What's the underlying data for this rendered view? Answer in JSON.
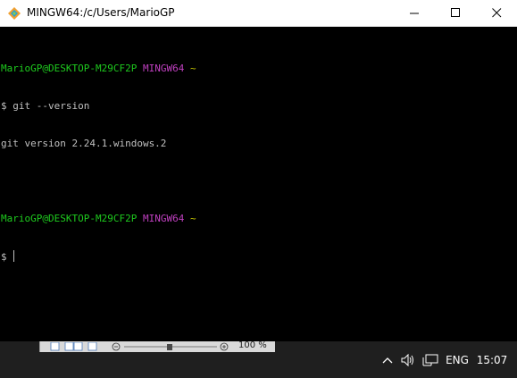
{
  "window": {
    "title": "MINGW64:/c/Users/MarioGP",
    "icon": "git-bash-diamond-icon",
    "controls": [
      "minimize-icon",
      "maximize-icon",
      "close-icon"
    ]
  },
  "terminal": {
    "prompt1": {
      "user_host": "MarioGP@DESKTOP-M29CF2P",
      "env": "MINGW64",
      "path": "~"
    },
    "cmd1": "$ git --version",
    "out1": "git version 2.24.1.windows.2",
    "prompt2": {
      "user_host": "MarioGP@DESKTOP-M29CF2P",
      "env": "MINGW64",
      "path": "~"
    },
    "cmd2": "$ "
  },
  "background_window": {
    "zoom_level": "100 %"
  },
  "taskbar": {
    "language": "ENG",
    "time": "15:07",
    "icons": [
      "chevron-up-icon",
      "volume-icon",
      "network-icon"
    ]
  },
  "colors": {
    "prompt_user": "#1ecb1e",
    "prompt_env": "#c040c0",
    "prompt_path": "#c8c800",
    "text": "#c0c0c0",
    "background": "#000000",
    "taskbar": "#1f1f1f"
  }
}
